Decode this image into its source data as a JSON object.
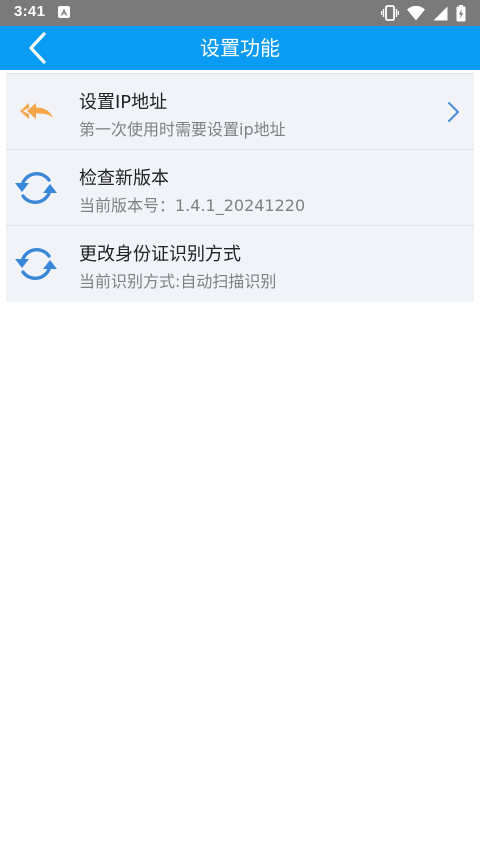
{
  "status_bar": {
    "time": "3:41",
    "notification_icon": "a-square-icon",
    "right_icons": [
      "vibrate-icon",
      "wifi-icon",
      "signal-icon",
      "battery-icon"
    ]
  },
  "app_bar": {
    "title": "设置功能",
    "back_icon": "chevron-left-icon",
    "background_color": "#0a9bf5"
  },
  "settings": {
    "items": [
      {
        "title": "设置IP地址",
        "subtitle": "第一次使用时需要设置ip地址",
        "icon": "reply-all-icon",
        "icon_color": "#f5a54a",
        "has_chevron": true
      },
      {
        "title": "检查新版本",
        "subtitle": "当前版本号：1.4.1_20241220",
        "icon": "sync-icon",
        "icon_color": "#3a86d8",
        "has_chevron": false
      },
      {
        "title": "更改身份证识别方式",
        "subtitle": "当前识别方式:自动扫描识别",
        "icon": "sync-icon",
        "icon_color": "#3a86d8",
        "has_chevron": false
      }
    ]
  }
}
